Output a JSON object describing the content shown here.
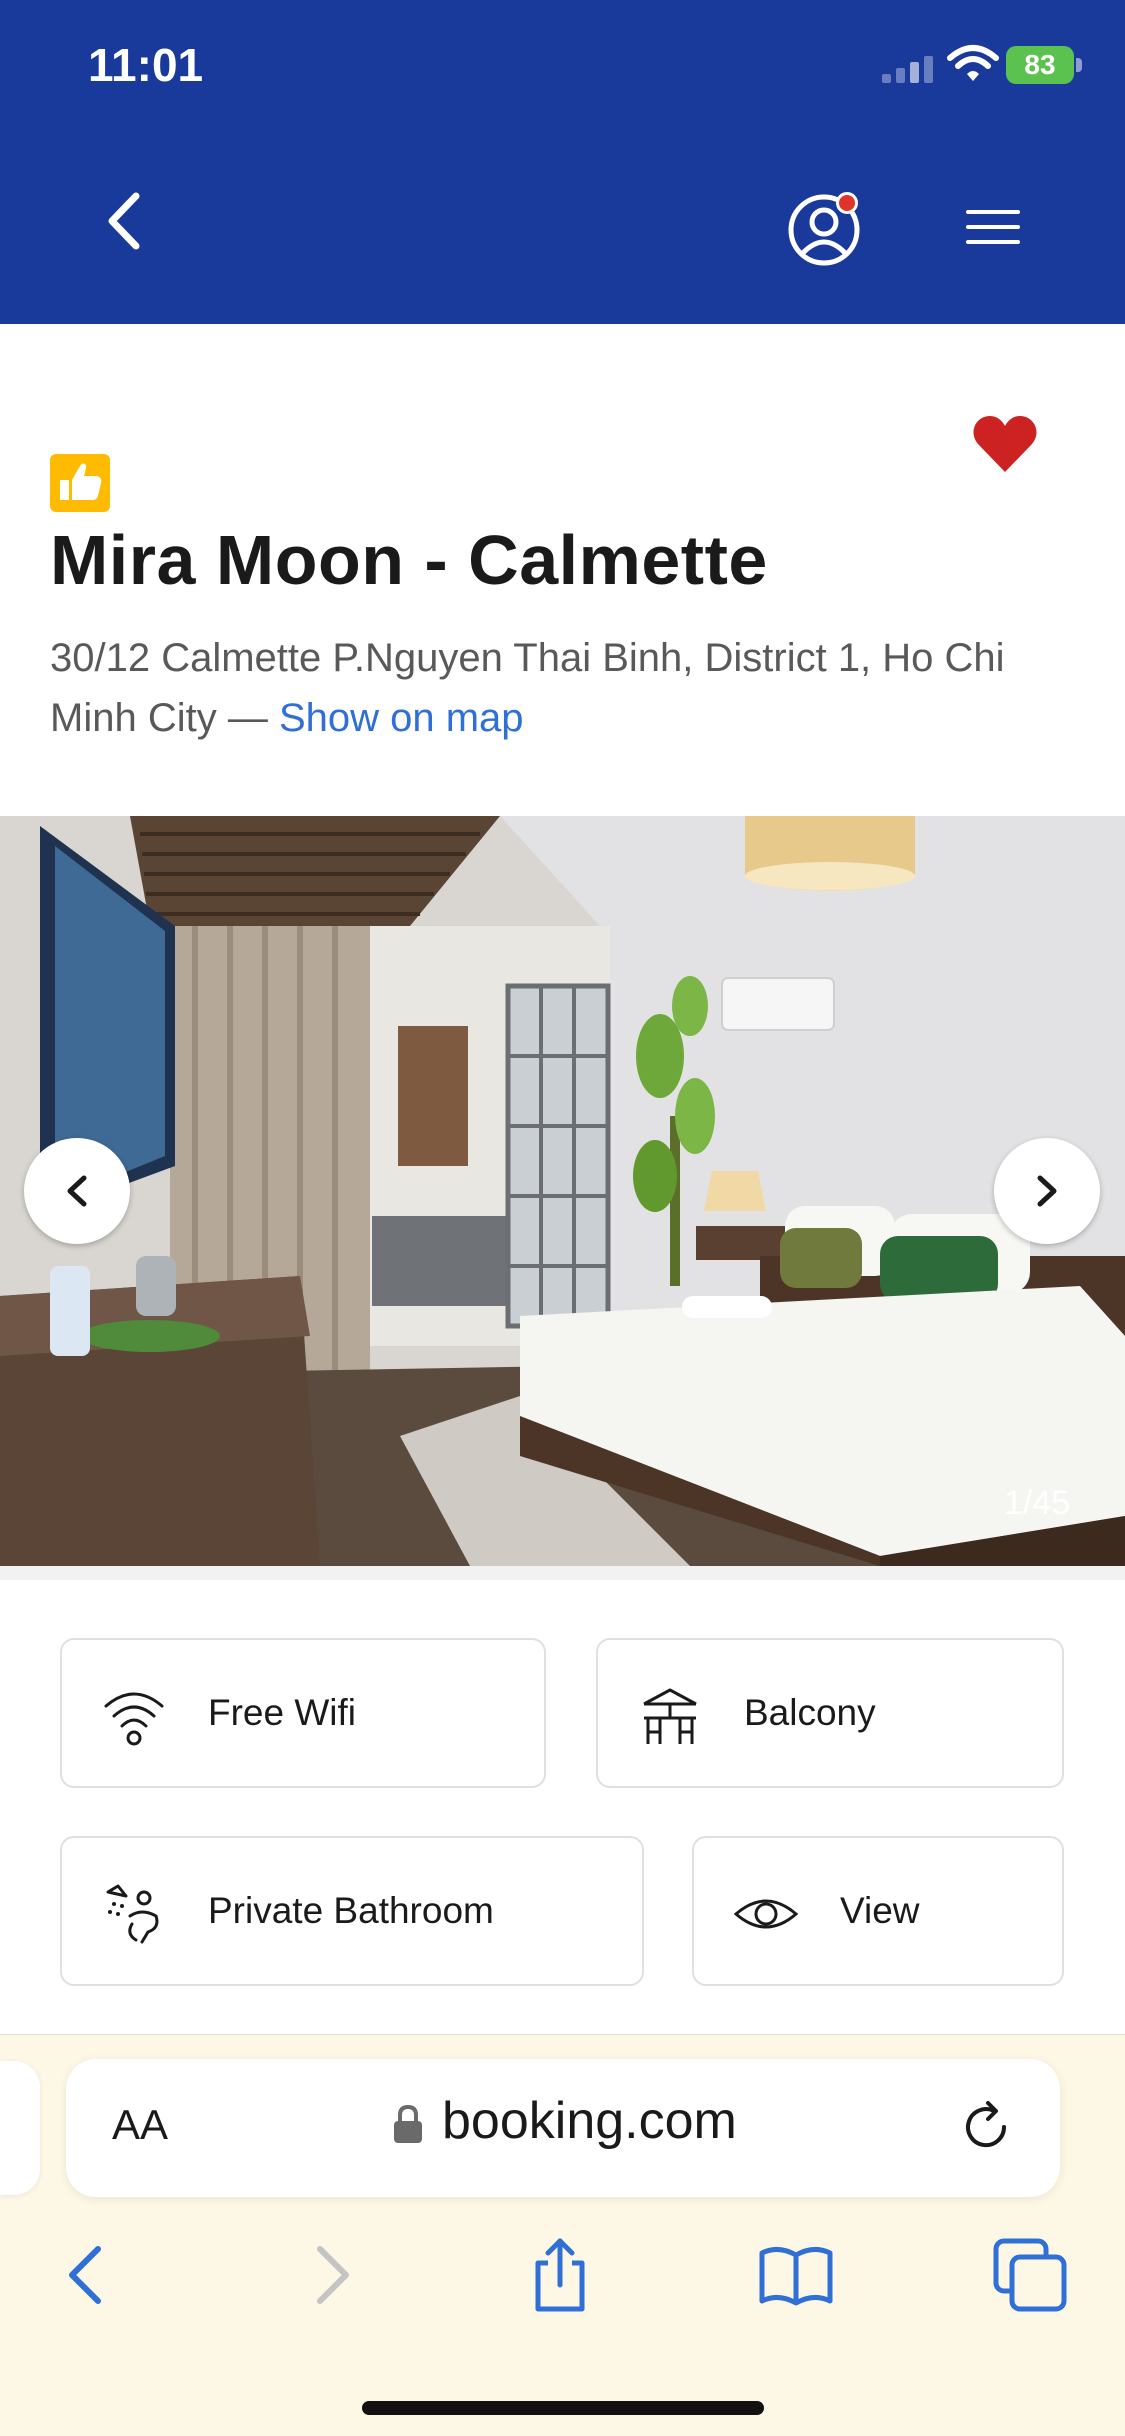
{
  "status_bar": {
    "time": "11:01",
    "battery": "83"
  },
  "header": {
    "back_icon": "chevron-left-icon",
    "account_icon": "user-circle-icon",
    "menu_icon": "hamburger-menu-icon",
    "brand_color": "#1a3a9b",
    "notification_color": "#e2332b"
  },
  "property": {
    "name": "Mira Moon - Calmette",
    "address": "30/12 Calmette P.Nguyen Thai Binh, District 1, Ho Chi Minh City — ",
    "map_link": "Show on map",
    "favorite_icon": "heart-icon",
    "favorite_color": "#cc2222",
    "badge_icon": "thumbs-up-icon"
  },
  "gallery": {
    "counter": "1/45"
  },
  "facilities": [
    {
      "label": "Free Wifi",
      "icon": "wifi-icon"
    },
    {
      "label": "Balcony",
      "icon": "balcony-icon"
    },
    {
      "label": "Private Bathroom",
      "icon": "bathroom-icon"
    },
    {
      "label": "View",
      "icon": "eye-icon"
    }
  ],
  "browser": {
    "text_size_label": "AA",
    "domain": "booking.com",
    "toolbar_icons": [
      "back-arrow-icon",
      "forward-arrow-icon",
      "share-icon",
      "bookmarks-icon",
      "tabs-icon"
    ]
  }
}
